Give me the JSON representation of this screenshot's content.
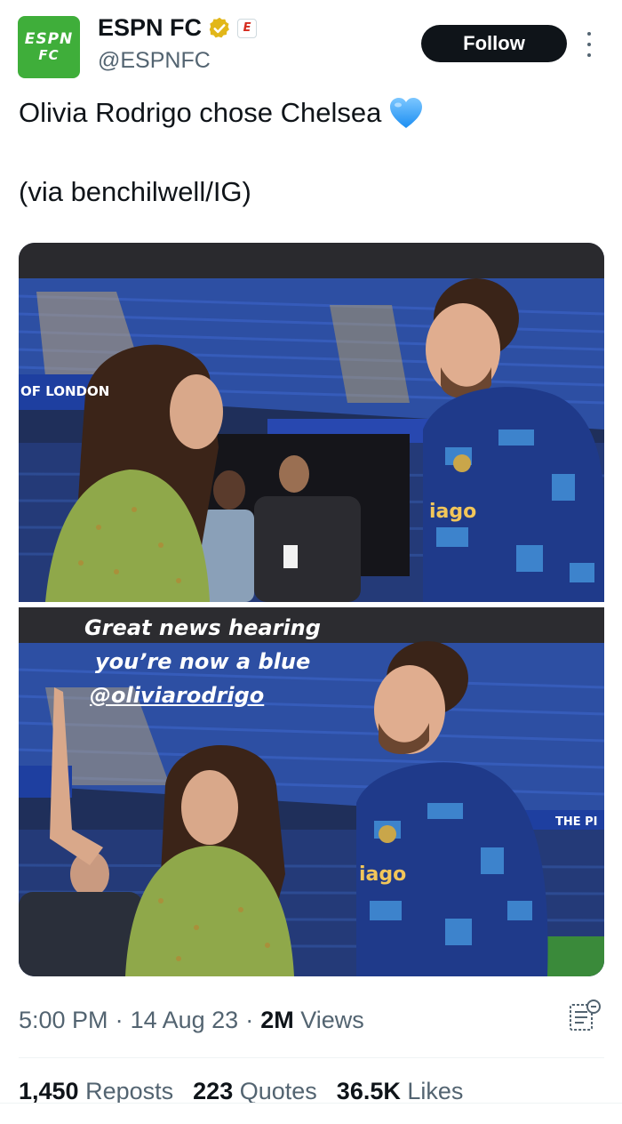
{
  "account": {
    "display_name": "ESPN FC",
    "handle": "@ESPNFC",
    "avatar_line1": "ESPN",
    "avatar_line2": "FC",
    "affiliate_badge": "E"
  },
  "actions": {
    "follow_label": "Follow",
    "more_icon": "more-vertical-icon"
  },
  "tweet": {
    "text_line1": "Olivia Rodrigo chose Chelsea",
    "emoji": "blue-heart-icon",
    "text_line2": "(via benchilwell/IG)"
  },
  "media": {
    "photo1_signage": "OF LONDON",
    "photo1_shirt_text": "iago",
    "photo2_caption_line1": "Great news hearing",
    "photo2_caption_line2": "you’re now a blue",
    "photo2_caption_mention": "@oliviarodrigo",
    "photo2_shirt_text": "iago",
    "photo2_signage": "THE PI"
  },
  "meta": {
    "time": "5:00 PM",
    "date": "14 Aug 23",
    "views_count": "2M",
    "views_label": "Views",
    "separator": "·"
  },
  "stats": {
    "reposts_count": "1,450",
    "reposts_label": "Reposts",
    "quotes_count": "223",
    "quotes_label": "Quotes",
    "likes_count": "36.5K",
    "likes_label": "Likes"
  },
  "colors": {
    "accent": "#0f1419",
    "muted": "#536471",
    "verified_gold": "#e2b719",
    "espn_green": "#3fae3a",
    "chelsea_blue": "#1f3a8a"
  }
}
